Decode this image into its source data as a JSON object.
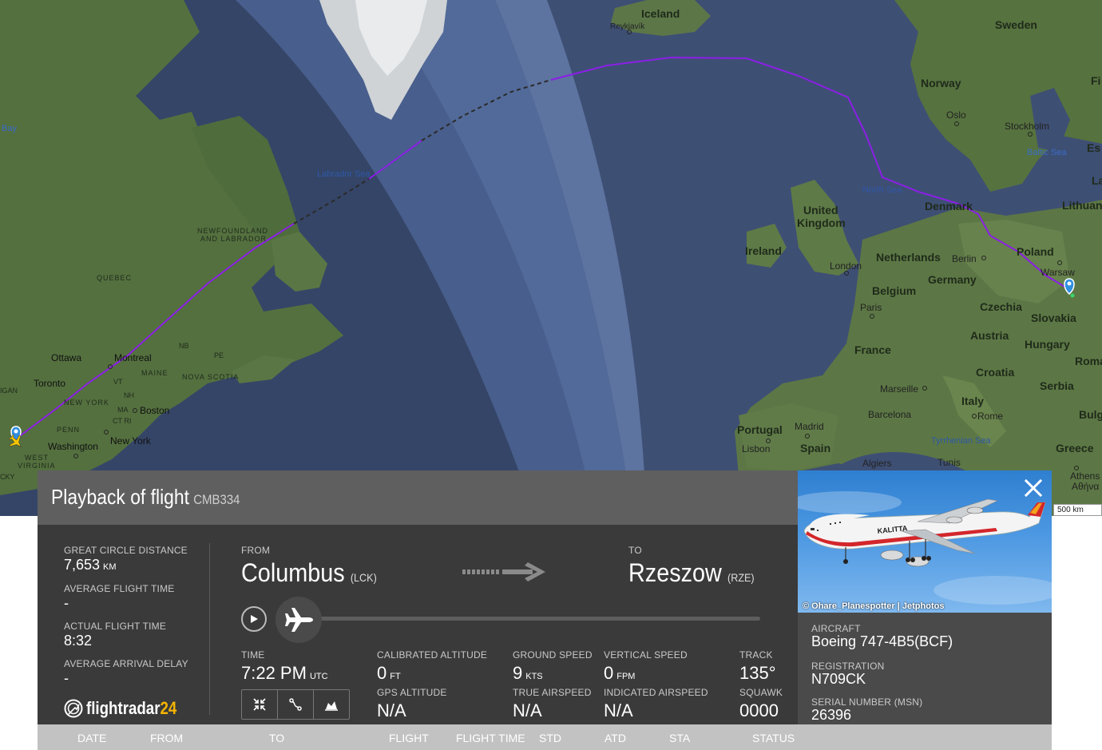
{
  "map": {
    "labels": {
      "iceland": "Iceland",
      "reykjavik": "Reykjavík",
      "sweden": "Sweden",
      "norway": "Norway",
      "oslo": "Oslo",
      "stockholm": "Stockholm",
      "baltic_sea": "Baltic Sea",
      "fi": "Fi",
      "es": "Es",
      "la": "La",
      "lithuania": "Lithuan",
      "bay": "Bay",
      "labrador_sea": "Labrador Sea",
      "north_sea": "North Sea",
      "denmark": "Denmark",
      "united_kingdom": "United Kingdom",
      "ireland": "Ireland",
      "london": "London",
      "netherlands": "Netherlands",
      "berlin": "Berlin",
      "poland": "Poland",
      "warsaw": "Warsaw",
      "belgium": "Belgium",
      "germany": "Germany",
      "paris": "Paris",
      "czechia": "Czechia",
      "slovakia": "Slovakia",
      "austria": "Austria",
      "hungary": "Hungary",
      "roma": "Roma",
      "france": "France",
      "croatia": "Croatia",
      "serbia": "Serbia",
      "marseille": "Marseille",
      "italy": "Italy",
      "barcelona": "Barcelona",
      "rome": "Rome",
      "bulg": "Bulg",
      "portugal": "Portugal",
      "madrid": "Madrid",
      "spain": "Spain",
      "lisbon": "Lisbon",
      "tyrrhenian_sea": "Tyrrhenian Sea",
      "greece": "Greece",
      "athens": "Athens",
      "athens_greek": "Αθήνα",
      "algiers": "Algiers",
      "tunis": "Tunis",
      "newfoundland_line1": "NEWFOUNDLAND",
      "newfoundland_line2": "AND LABRADOR",
      "quebec": "QUEBEC",
      "ottawa": "Ottawa",
      "montreal": "Montreal",
      "nb": "NB",
      "pe": "PE",
      "maine": "MAINE",
      "nova_scotia": "NOVA SCOTIA",
      "toronto": "Toronto",
      "vt": "VT",
      "nh": "NH",
      "igan": "IGAN",
      "new_york_state": "NEW YORK",
      "ma": "MA",
      "boston": "Boston",
      "ct_ri": "CT RI",
      "penn": "PENN",
      "new_york_city": "New York",
      "washington": "Washington",
      "west_virginia_line1": "WEST",
      "west_virginia_line2": "VIRGINIA",
      "cky": "CKY"
    },
    "scale_label": "500 km",
    "route_color": "#8b1fe6",
    "ocean_color": "#3c4d72",
    "land_color": "#54703f"
  },
  "panel": {
    "title": "Playback of flight",
    "callsign": "CMB334",
    "great_circle_distance_label": "GREAT CIRCLE DISTANCE",
    "great_circle_distance_value": "7,653",
    "great_circle_distance_unit": "KM",
    "average_flight_time_label": "AVERAGE FLIGHT TIME",
    "average_flight_time_value": "-",
    "actual_flight_time_label": "ACTUAL FLIGHT TIME",
    "actual_flight_time_value": "8:32",
    "average_arrival_delay_label": "AVERAGE ARRIVAL DELAY",
    "average_arrival_delay_value": "-",
    "from_label": "FROM",
    "from_city": "Columbus",
    "from_code": "(LCK)",
    "to_label": "TO",
    "to_city": "Rzeszow",
    "to_code": "(RZE)",
    "time_label": "TIME",
    "time_value": "7:22 PM",
    "time_unit": "UTC",
    "calibrated_altitude_label": "CALIBRATED ALTITUDE",
    "calibrated_altitude_value": "0",
    "calibrated_altitude_unit": "FT",
    "gps_altitude_label": "GPS ALTITUDE",
    "gps_altitude_value": "N/A",
    "ground_speed_label": "GROUND SPEED",
    "ground_speed_value": "9",
    "ground_speed_unit": "KTS",
    "true_airspeed_label": "TRUE AIRSPEED",
    "true_airspeed_value": "N/A",
    "vertical_speed_label": "VERTICAL SPEED",
    "vertical_speed_value": "0",
    "vertical_speed_unit": "FPM",
    "indicated_airspeed_label": "INDICATED AIRSPEED",
    "indicated_airspeed_value": "N/A",
    "track_label": "TRACK",
    "track_value": "135°",
    "squawk_label": "SQUAWK",
    "squawk_value": "0000",
    "logo_text": "flightradar",
    "logo_num": "24",
    "playback_progress": 0
  },
  "aircraft": {
    "photo_credit": "© Ohare_Planespotter | Jetphotos",
    "aircraft_label": "AIRCRAFT",
    "aircraft_value": "Boeing 747-4B5(BCF)",
    "registration_label": "REGISTRATION",
    "registration_value": "N709CK",
    "serial_label": "SERIAL NUMBER (MSN)",
    "serial_value": "26396",
    "livery_text": "KALITTA"
  },
  "table": {
    "headers": [
      "DATE",
      "FROM",
      "TO",
      "FLIGHT",
      "FLIGHT TIME",
      "STD",
      "ATD",
      "STA",
      "STATUS"
    ]
  },
  "icons": {
    "play": "play-icon",
    "airplane": "airplane-icon",
    "close": "close-icon",
    "compress": "compress-icon",
    "route": "route-icon",
    "chart": "altitude-chart-icon",
    "origin_pin": "map-pin-icon",
    "dest_pin": "map-pin-icon"
  }
}
